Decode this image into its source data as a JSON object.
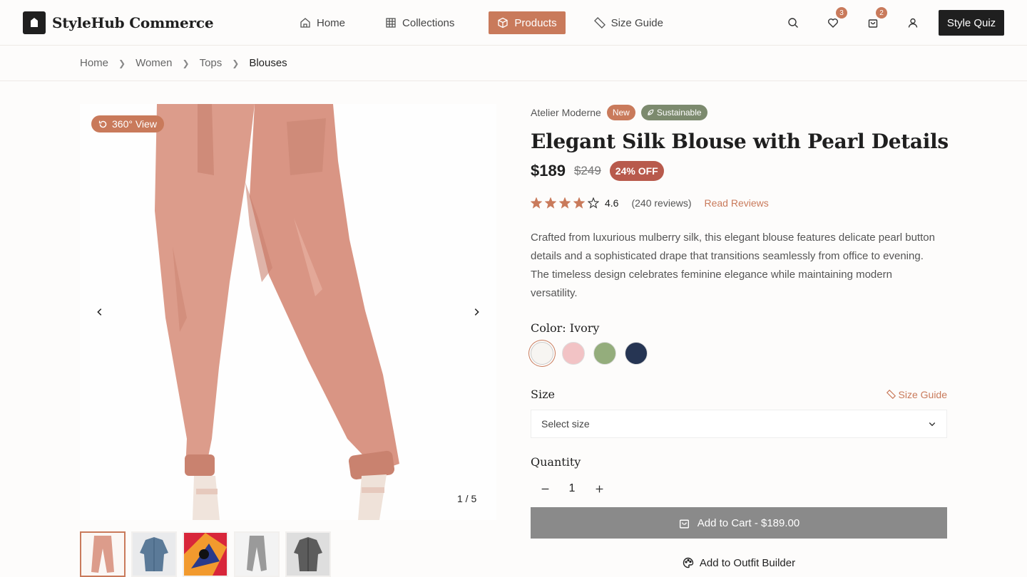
{
  "header": {
    "brand": "StyleHub Commerce",
    "nav": [
      {
        "label": "Home",
        "icon": "home-icon"
      },
      {
        "label": "Collections",
        "icon": "grid-icon"
      },
      {
        "label": "Products",
        "icon": "box-icon",
        "active": true
      },
      {
        "label": "Size Guide",
        "icon": "ruler-icon"
      }
    ],
    "wishlist_count": "3",
    "cart_count": "2",
    "quiz_label": "Style Quiz"
  },
  "breadcrumb": [
    "Home",
    "Women",
    "Tops",
    "Blouses"
  ],
  "gallery": {
    "view360_label": "360° View",
    "counter": "1 / 5",
    "thumbnails": [
      "pink-pants",
      "denim-shirt",
      "colorful-art",
      "grey-pants",
      "grey-shirt"
    ]
  },
  "product": {
    "brand": "Atelier Moderne",
    "new_badge": "New",
    "sustainable_badge": "Sustainable",
    "title": "Elegant Silk Blouse with Pearl Details",
    "price": "$189",
    "old_price": "$249",
    "discount": "24% OFF",
    "rating": "4.6",
    "rating_value": 4.6,
    "reviews": "(240 reviews)",
    "read_reviews": "Read Reviews",
    "description": "Crafted from luxurious mulberry silk, this elegant blouse features delicate pearl button details and a sophisticated drape that transitions seamlessly from office to evening. The timeless design celebrates feminine elegance while maintaining modern versatility.",
    "color_label": "Color: Ivory",
    "colors": [
      "#f7f5f2",
      "#f2c3c5",
      "#94ad7c",
      "#263553"
    ],
    "size_label": "Size",
    "size_guide": "Size Guide",
    "size_placeholder": "Select size",
    "quantity_label": "Quantity",
    "quantity": "1",
    "add_to_cart": "Add to Cart - $189.00",
    "outfit_builder": "Add to Outfit Builder"
  },
  "colors": {
    "accent": "#c97a5b",
    "dark": "#1f1f1f",
    "sale": "#b85a4c",
    "sustainable": "#7c8a6e"
  }
}
